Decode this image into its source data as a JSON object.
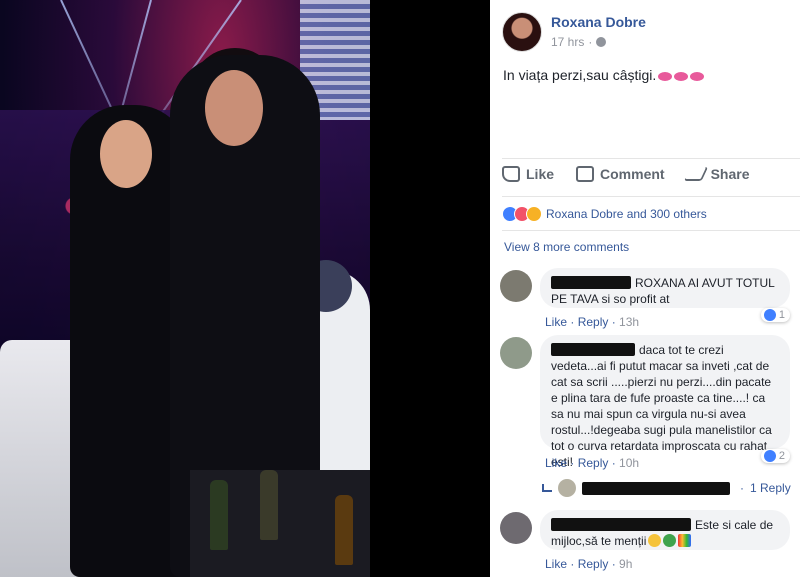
{
  "post": {
    "author": "Roxana Dobre",
    "time": "17 hrs",
    "text": "In viața perzi,sau câștigi.",
    "actions": {
      "like": "Like",
      "comment": "Comment",
      "share": "Share"
    },
    "reactions_text": "Roxana Dobre and 300 others",
    "view_more": "View 8 more comments"
  },
  "comments": [
    {
      "text": "ROXANA AI AVUT TOTUL PE TAVA si so profit at",
      "like": "Like",
      "reply": "Reply",
      "time": "13h",
      "count": "1"
    },
    {
      "text": "daca tot te crezi vedeta...ai fi putut macar sa inveti ,cat de cat sa scrii .....pierzi nu perzi....din pacate e plina tara de fufe proaste ca tine....! ca sa nu mai spun ca virgula nu-si avea rostul...!degeaba sugi pula manelistilor ca tot o curva retardata improscata cu rahat esti!",
      "like": "Like",
      "reply": "Reply",
      "time": "10h",
      "count": "2",
      "replies": "1 Reply"
    },
    {
      "text": "Este si cale de mijloc,să te menții",
      "like": "Like",
      "reply": "Reply",
      "time": "9h"
    }
  ],
  "colors": {
    "link": "#365899",
    "meta": "#90949c",
    "bubble": "#f2f3f5"
  },
  "icons": [
    "globe-icon",
    "kiss-icon",
    "like-icon",
    "comment-icon",
    "share-icon",
    "love-reaction-icon",
    "wow-reaction-icon"
  ]
}
